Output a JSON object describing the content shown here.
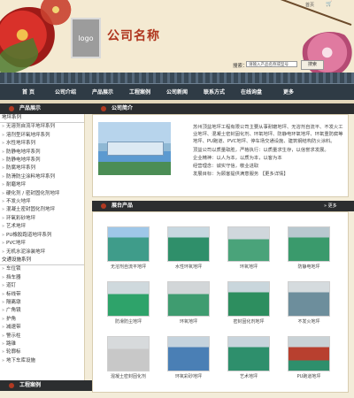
{
  "header": {
    "logo": "logo",
    "company_name": "公司名称",
    "top_links": "首页",
    "search_label": "搜索：",
    "search_placeholder": "请输入产品名称或型号",
    "search_button": "搜索"
  },
  "nav": [
    "首 页",
    "公司介绍",
    "产品展示",
    "工程案例",
    "公司新闻",
    "联系方式",
    "在线询盘",
    "更多"
  ],
  "left": {
    "title": "产品展示",
    "groups": [
      {
        "name": "地坪系列",
        "items": [
          "无溶剂自流平地坪系列",
          "溶剂型环氧地坪系列",
          "水性地坪系列",
          "防静电地坪系列",
          "防静电地坪系列",
          "防腐地坪系列",
          "防滑防尘涂料地坪系列",
          "耐磨地坪",
          "硬化剂 / 密封固化剂地坪",
          "不发火地坪",
          "混凝土密封固化剂地坪",
          "环氧彩砂地坪",
          "艺术地坪",
          "PU橡胶跑道地坪系列",
          "PVC地坪",
          "无机水泥涂装地坪"
        ]
      },
      {
        "name": "交通设施系列",
        "items": [
          "车位锁",
          "挡车器",
          "道钉",
          "标线带",
          "隔离墩",
          "广角镜",
          "护角",
          "减速带",
          "警示柱",
          "路锥",
          "轮廓标",
          "地下车库设施"
        ]
      }
    ],
    "title2": "工程案例"
  },
  "about": {
    "title": "公司简介",
    "paragraphs": [
      "苏州顶益地坪工程有限公司主要从事耐磨地坪、无溶剂自流平、不发火工业地坪、混凝土密封固化剂、环氧地坪、防静电环氧地坪、环氧重防腐等地坪、PU跑道、PVC地坪、停车场交通设施、建筑钢结构防火涂料。",
      "顶益公司以质量取胜，严格执行：以质量求生存，以信誉求发展。",
      "企业精神：以人为本，以质为本，以客为本",
      "经营理念：诚实守信，敬业进取",
      "发展目标：为顾客提供满意服务 【更多详情】"
    ]
  },
  "products": {
    "title": "展台产品",
    "more": "» 更多",
    "items": [
      {
        "name": "无溶剂自流平地坪"
      },
      {
        "name": "水性环氧地坪"
      },
      {
        "name": "环氧地坪"
      },
      {
        "name": "防静电地坪"
      },
      {
        "name": "防滑防尘地坪"
      },
      {
        "name": "环氧地坪"
      },
      {
        "name": "密封固化剂地坪"
      },
      {
        "name": "不发火地坪"
      },
      {
        "name": "混凝土密封固化剂"
      },
      {
        "name": "环氧彩砂地坪"
      },
      {
        "name": "艺术地坪"
      },
      {
        "name": "PU跑道地坪"
      }
    ]
  },
  "colors": {
    "accent": "#b03a22",
    "nav_bg": "#2f3b45",
    "page_bg": "#f3ecd9"
  }
}
